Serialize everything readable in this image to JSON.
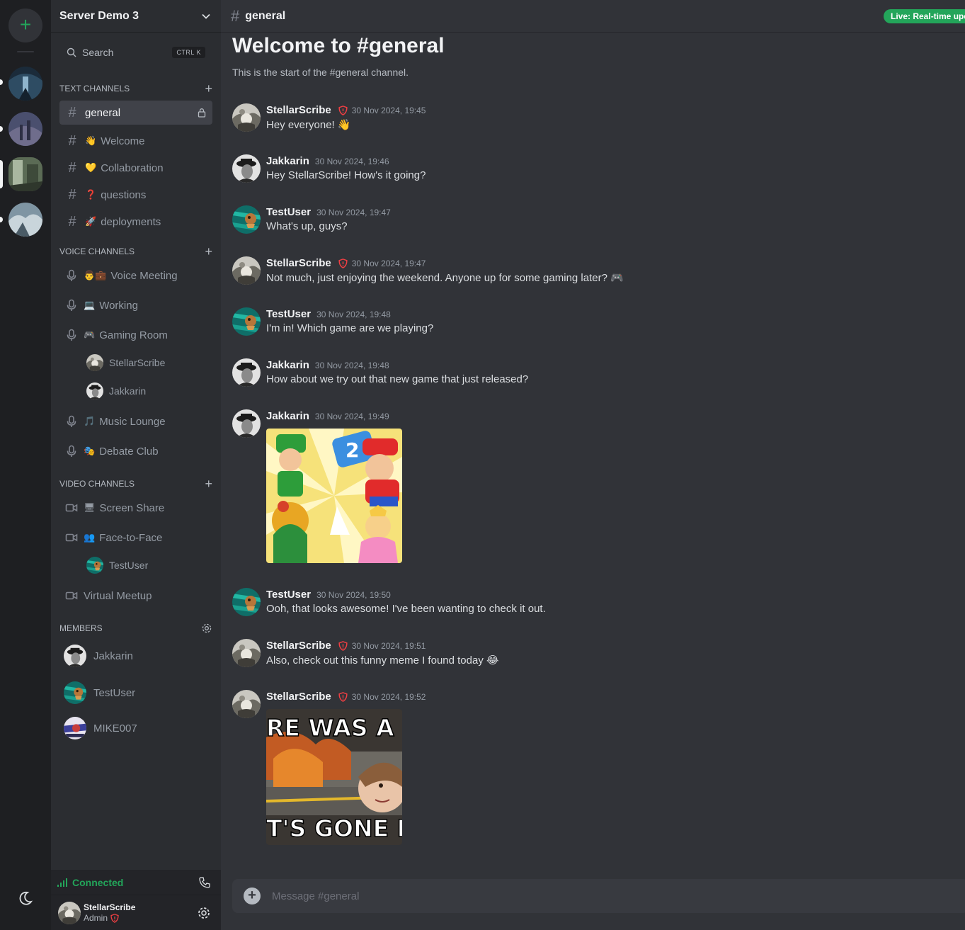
{
  "server": {
    "name": "Server Demo 3",
    "search_label": "Search",
    "search_shortcut": "CTRL K"
  },
  "sections": {
    "text": "TEXT CHANNELS",
    "voice": "VOICE CHANNELS",
    "video": "VIDEO CHANNELS",
    "members": "MEMBERS"
  },
  "text_channels": [
    {
      "name": "general",
      "emoji": ""
    },
    {
      "name": "Welcome",
      "emoji": "👋"
    },
    {
      "name": "Collaboration",
      "emoji": "💛"
    },
    {
      "name": "questions",
      "emoji": "❓"
    },
    {
      "name": "deployments",
      "emoji": "🚀"
    }
  ],
  "voice_channels": [
    {
      "name": "Voice Meeting",
      "emoji": "👨💼"
    },
    {
      "name": "Working",
      "emoji": "💻"
    },
    {
      "name": "Gaming Room",
      "emoji": "🎮"
    },
    {
      "name": "Music Lounge",
      "emoji": "🎵"
    },
    {
      "name": "Debate Club",
      "emoji": "🎭"
    }
  ],
  "voice_users": [
    "StellarScribe",
    "Jakkarin"
  ],
  "video_channels": [
    {
      "name": "Screen Share",
      "emoji": "🖥"
    },
    {
      "name": "Face-to-Face",
      "emoji": "👥"
    },
    {
      "name": "Virtual Meetup",
      "emoji": ""
    }
  ],
  "video_users": [
    "TestUser"
  ],
  "members": [
    "Jakkarin",
    "TestUser",
    "MIKE007"
  ],
  "connection": {
    "status": "Connected"
  },
  "current_user": {
    "name": "StellarScribe",
    "role": "Admin"
  },
  "channel": {
    "name": "general",
    "welcome_title": "Welcome to #general",
    "welcome_sub": "This is the start of the #general channel.",
    "live_badge": "Live: Real-time updates"
  },
  "messages": [
    {
      "author": "StellarScribe",
      "time": "30 Nov 2024, 19:45",
      "text": "Hey everyone! 👋",
      "admin": true
    },
    {
      "author": "Jakkarin",
      "time": "30 Nov 2024, 19:46",
      "text": "Hey StellarScribe! How's it going?",
      "admin": false
    },
    {
      "author": "TestUser",
      "time": "30 Nov 2024, 19:47",
      "text": "What's up, guys?",
      "admin": false
    },
    {
      "author": "StellarScribe",
      "time": "30 Nov 2024, 19:47",
      "text": "Not much, just enjoying the weekend. Anyone up for some gaming later? 🎮",
      "admin": true
    },
    {
      "author": "TestUser",
      "time": "30 Nov 2024, 19:48",
      "text": "I'm in! Which game are we playing?",
      "admin": false
    },
    {
      "author": "Jakkarin",
      "time": "30 Nov 2024, 19:48",
      "text": "How about we try out that new game that just released?",
      "admin": false
    },
    {
      "author": "Jakkarin",
      "time": "30 Nov 2024, 19:49",
      "text": "",
      "admin": false
    },
    {
      "author": "TestUser",
      "time": "30 Nov 2024, 19:50",
      "text": "Ooh, that looks awesome! I've been wanting to check it out.",
      "admin": false
    },
    {
      "author": "StellarScribe",
      "time": "30 Nov 2024, 19:51",
      "text": "Also, check out this funny meme I found today 😂",
      "admin": true
    },
    {
      "author": "StellarScribe",
      "time": "30 Nov 2024, 19:52",
      "text": "",
      "admin": true
    }
  ],
  "meme": {
    "top": "RE WAS A SPI",
    "bottom": "T'S GONE NOV"
  },
  "composer": {
    "placeholder": "Message #general"
  },
  "colors": {
    "accent_green": "#23a55a",
    "admin_red": "#f23f43"
  }
}
